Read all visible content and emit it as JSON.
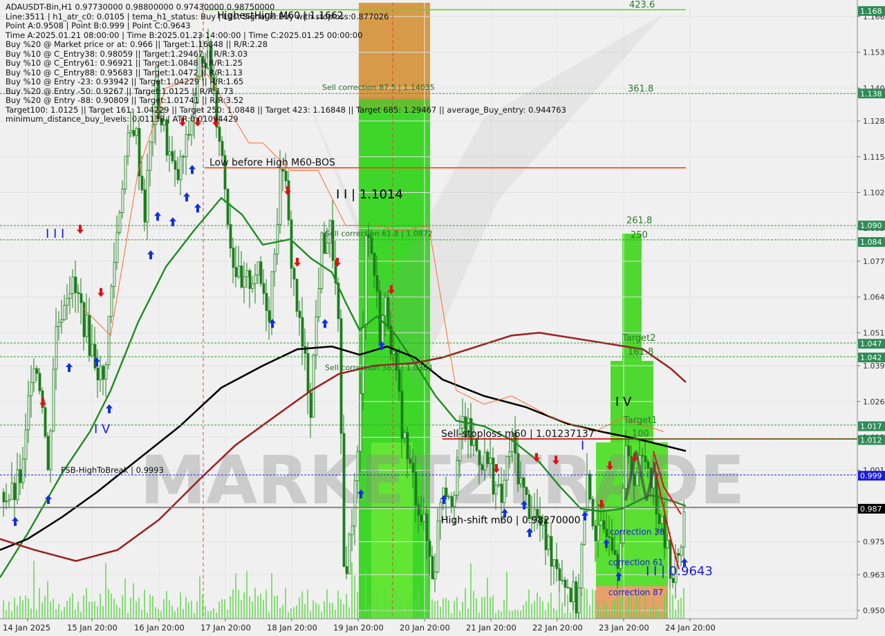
{
  "header": {
    "lines": [
      "ADAUSDT-Bin,H1  0.97730000 0.98800000 0.97430000 0.98750000",
      "Line:3511 | h1_atr_c0: 0.0105 | tema_h1_status: Buy | Last Signal is:Buy with stoploss:0.877026",
      "Point A:0.9508 | Point B:0.999 | Point C:0.9643",
      "Time A:2025.01.21 08:00:00 | Time B:2025.01.23 14:00:00 | Time C:2025.01.25 00:00:00",
      "Buy %20 @ Market price or at: 0.966 || Target:1.16848 || R/R:2.28",
      "Buy %10 @ C_Entry38: 0.98059 || Target:1.29467 || R/R:3.03",
      "Buy %10 @ C_Entry61: 0.96921 || Target:1.0848 || R/R:1.25",
      "Buy %10 @ C_Entry88: 0.95683 || Target:1.0472 || R/R:1.13",
      "Buy %10 @ Entry -23: 0.93942 || Target:1.04229 || R/R:1.65",
      "Buy %20 @ Entry -50: 0.9267 || Target:1.0125 || R/R:1.73",
      "Buy %20 @ Entry -88: 0.90809 || Target:1.01741 || R/R:3.52",
      "Target100: 1.0125 || Target 161: 1.04229 || Target 250: 1.0848 || Target 423: 1.16848 || Target 685: 1.29467 || average_Buy_entry: 0.944763",
      "minimum_distance_buy_levels: 0.01138 | ATR:0.01094429"
    ]
  },
  "chart_data": {
    "type": "candlestick",
    "symbol": "ADAUSDT-Bin",
    "timeframe": "H1",
    "ohlc_last": {
      "open": 0.9773,
      "high": 0.988,
      "low": 0.9743,
      "close": 0.9875
    },
    "ylim": [
      0.947,
      1.171
    ],
    "y_ticks": [
      0.95,
      0.963,
      0.975,
      0.987,
      1.001,
      1.013,
      1.026,
      1.039,
      1.051,
      1.064,
      1.077,
      1.089,
      1.102,
      1.115,
      1.128,
      1.14,
      1.153,
      1.166
    ],
    "x_ticks": [
      "14 Jan 2025",
      "15 Jan 20:00",
      "16 Jan 20:00",
      "17 Jan 20:00",
      "18 Jan 20:00",
      "19 Jan 20:00",
      "20 Jan 20:00",
      "21 Jan 20:00",
      "22 Jan 20:00",
      "23 Jan 20:00",
      "24 Jan 20:00"
    ],
    "price_badges": [
      {
        "value": 1.168,
        "text": "1.168",
        "color": "#2e8b57"
      },
      {
        "value": 1.138,
        "text": "1.138",
        "color": "#2e8b57"
      },
      {
        "value": 1.09,
        "text": "1.090",
        "color": "#2e8b57"
      },
      {
        "value": 1.084,
        "text": "1.084",
        "color": "#2e8b57"
      },
      {
        "value": 1.047,
        "text": "1.047",
        "color": "#2e8b57"
      },
      {
        "value": 1.042,
        "text": "1.042",
        "color": "#2e8b57"
      },
      {
        "value": 1.017,
        "text": "1.017",
        "color": "#2e8b57"
      },
      {
        "value": 1.012,
        "text": "1.012",
        "color": "#2e8b57"
      },
      {
        "value": 0.999,
        "text": "0.999",
        "color": "#1a1adf"
      },
      {
        "value": 0.987,
        "text": "0.987",
        "color": "#000000"
      }
    ],
    "levels": [
      {
        "name": "target-423",
        "value": 1.16848,
        "label": "423.6",
        "color": "#5fd82a",
        "style": "solid"
      },
      {
        "name": "target-361",
        "value": 1.138,
        "label": "361.8",
        "color": "#2a9a2a",
        "style": "dashed"
      },
      {
        "name": "low-before-high",
        "value": 1.111,
        "label": "Low before High   M60-BOS",
        "color": "#ff3b10",
        "style": "solid"
      },
      {
        "name": "target-261",
        "value": 1.09,
        "label": "261.8",
        "color": "#2a9a2a",
        "style": "dashed"
      },
      {
        "name": "target-250",
        "value": 1.0848,
        "label": "250",
        "color": "#2a9a2a",
        "style": "dashed"
      },
      {
        "name": "target2",
        "value": 1.04729,
        "label": "Target2",
        "color": "#2a9a2a",
        "style": "dashed"
      },
      {
        "name": "target-161",
        "value": 1.04229,
        "label": "161.8",
        "color": "#2a9a2a",
        "style": "dashed"
      },
      {
        "name": "target1",
        "value": 1.01741,
        "label": "Target1",
        "color": "#2a9a2a",
        "style": "dashed"
      },
      {
        "name": "sell-stoploss",
        "value": 1.01237,
        "label": "Sell-stoploss m60 | 1.01237137",
        "color": "#d00000",
        "style": "solid"
      },
      {
        "name": "target-100",
        "value": 1.0125,
        "label": "100",
        "color": "#2a9a2a",
        "style": "dashed"
      },
      {
        "name": "fsb-high",
        "value": 0.9993,
        "label": "FSB-HighToBreak | 0.9993",
        "color": "#1a1adf",
        "style": "dashed"
      },
      {
        "name": "current-price",
        "value": 0.9875,
        "label": "",
        "color": "#777777",
        "style": "solid"
      }
    ],
    "annotations": [
      {
        "text": "HighestHigh   M60 | 1.1662",
        "value": 1.1662,
        "color": "#000"
      },
      {
        "text": "I I | 1.1014",
        "value": 1.1014,
        "color": "#000"
      },
      {
        "text": "Sell correction 87.5 | 1.14035",
        "value": 1.14035,
        "color": "#2a6a2a"
      },
      {
        "text": "Sell correction 61.8 | 1.0872",
        "value": 1.0872,
        "color": "#2a6a2a"
      },
      {
        "text": "Sell correction 38.2 | 1.0384",
        "value": 1.0384,
        "color": "#2a6a2a"
      },
      {
        "text": "High-shift m60 | 0.98270000",
        "value": 0.9827,
        "color": "#000"
      },
      {
        "text": "correction 38",
        "value": 0.9785,
        "color": "#1a1adf"
      },
      {
        "text": "correction 61",
        "value": 0.9675,
        "color": "#1a1adf"
      },
      {
        "text": "correction 87",
        "value": 0.9565,
        "color": "#1a1adf"
      },
      {
        "text": "I I | 0.9643",
        "value": 0.9643,
        "color": "#1a1adf"
      },
      {
        "text": "I I I",
        "value": 1.087,
        "color": "#1a1adf"
      },
      {
        "text": "I V",
        "value": 1.016,
        "color": "#1a1adf"
      },
      {
        "text": "I V",
        "value": 1.026,
        "color": "#000"
      },
      {
        "text": "I",
        "value": 1.01,
        "color": "#1a1adf"
      }
    ],
    "watermark": "MARKET2TRADE",
    "series": [
      {
        "name": "tema",
        "color": "#1e8c1e"
      },
      {
        "name": "ma200",
        "color": "#000000"
      },
      {
        "name": "ma-slow",
        "color": "#9b2424"
      }
    ]
  },
  "colors": {
    "bull": "#1a8c1a",
    "bear": "#1a8c1a",
    "bg": "#f0f0f0",
    "green_zone": "#3fdc2a",
    "orange_zone": "#d69a48"
  }
}
